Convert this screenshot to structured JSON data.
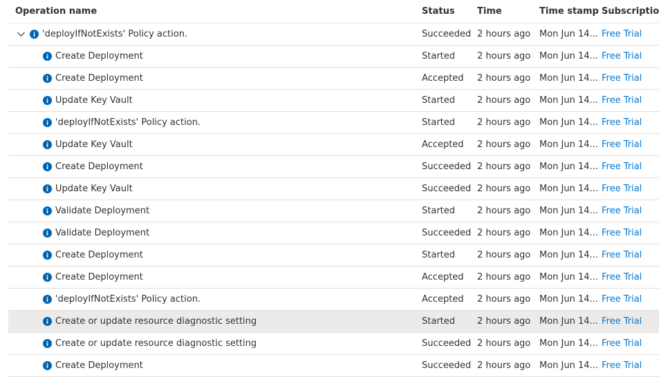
{
  "columns": {
    "operation_name": "Operation name",
    "status": "Status",
    "time": "Time",
    "time_stamp": "Time stamp",
    "subscription": "Subscription"
  },
  "icons": {
    "expand": "chevron-down-icon",
    "info": "info-icon"
  },
  "colors": {
    "link": "#0078d4",
    "info_icon": "#0063b1",
    "selected_row": "#edebe9"
  },
  "rows": [
    {
      "name": "'deployIfNotExists' Policy action.",
      "status": "Succeeded",
      "time": "2 hours ago",
      "stamp": "Mon Jun 14...",
      "subscription": "Free Trial"
    },
    {
      "name": "Create Deployment",
      "status": "Started",
      "time": "2 hours ago",
      "stamp": "Mon Jun 14...",
      "subscription": "Free Trial"
    },
    {
      "name": "Create Deployment",
      "status": "Accepted",
      "time": "2 hours ago",
      "stamp": "Mon Jun 14...",
      "subscription": "Free Trial"
    },
    {
      "name": "Update Key Vault",
      "status": "Started",
      "time": "2 hours ago",
      "stamp": "Mon Jun 14...",
      "subscription": "Free Trial"
    },
    {
      "name": "'deployIfNotExists' Policy action.",
      "status": "Started",
      "time": "2 hours ago",
      "stamp": "Mon Jun 14...",
      "subscription": "Free Trial"
    },
    {
      "name": "Update Key Vault",
      "status": "Accepted",
      "time": "2 hours ago",
      "stamp": "Mon Jun 14...",
      "subscription": "Free Trial"
    },
    {
      "name": "Create Deployment",
      "status": "Succeeded",
      "time": "2 hours ago",
      "stamp": "Mon Jun 14...",
      "subscription": "Free Trial"
    },
    {
      "name": "Update Key Vault",
      "status": "Succeeded",
      "time": "2 hours ago",
      "stamp": "Mon Jun 14...",
      "subscription": "Free Trial"
    },
    {
      "name": "Validate Deployment",
      "status": "Started",
      "time": "2 hours ago",
      "stamp": "Mon Jun 14...",
      "subscription": "Free Trial"
    },
    {
      "name": "Validate Deployment",
      "status": "Succeeded",
      "time": "2 hours ago",
      "stamp": "Mon Jun 14...",
      "subscription": "Free Trial"
    },
    {
      "name": "Create Deployment",
      "status": "Started",
      "time": "2 hours ago",
      "stamp": "Mon Jun 14...",
      "subscription": "Free Trial"
    },
    {
      "name": "Create Deployment",
      "status": "Accepted",
      "time": "2 hours ago",
      "stamp": "Mon Jun 14...",
      "subscription": "Free Trial"
    },
    {
      "name": "'deployIfNotExists' Policy action.",
      "status": "Accepted",
      "time": "2 hours ago",
      "stamp": "Mon Jun 14...",
      "subscription": "Free Trial"
    },
    {
      "name": "Create or update resource diagnostic setting",
      "status": "Started",
      "time": "2 hours ago",
      "stamp": "Mon Jun 14...",
      "subscription": "Free Trial",
      "selected": true
    },
    {
      "name": "Create or update resource diagnostic setting",
      "status": "Succeeded",
      "time": "2 hours ago",
      "stamp": "Mon Jun 14...",
      "subscription": "Free Trial"
    },
    {
      "name": "Create Deployment",
      "status": "Succeeded",
      "time": "2 hours ago",
      "stamp": "Mon Jun 14...",
      "subscription": "Free Trial"
    }
  ]
}
